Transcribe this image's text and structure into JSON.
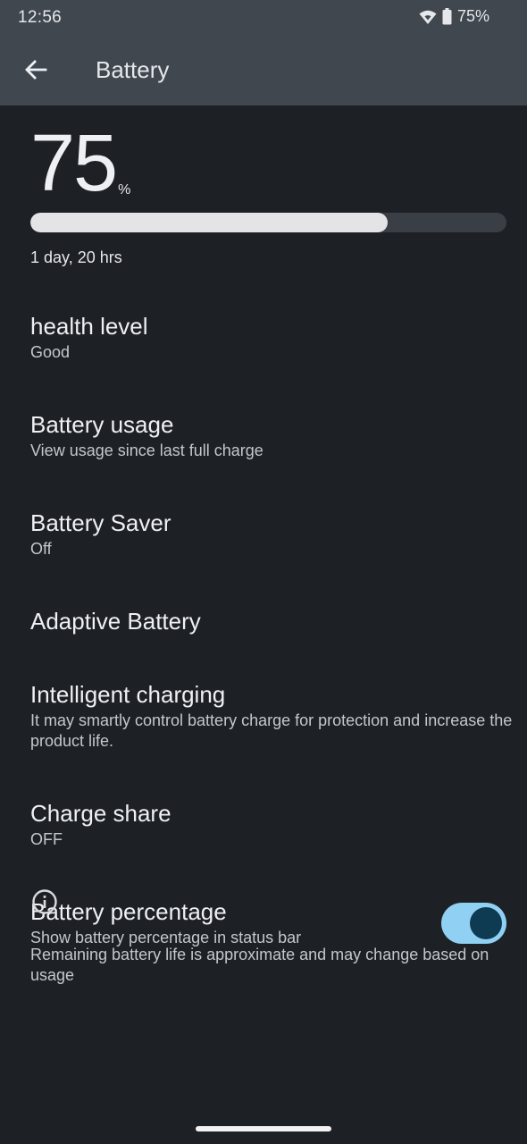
{
  "status_bar": {
    "time": "12:56",
    "battery_percent": "75%",
    "wifi_icon": "wifi-icon",
    "battery_icon": "battery-icon"
  },
  "app_bar": {
    "title": "Battery",
    "back_icon": "back-arrow-icon"
  },
  "battery": {
    "level": "75",
    "unit": "%",
    "level_fraction": 0.75,
    "remaining": "1 day, 20 hrs"
  },
  "items": [
    {
      "title": "health level",
      "subtitle": "Good"
    },
    {
      "title": "Battery usage",
      "subtitle": "View usage since last full charge"
    },
    {
      "title": "Battery Saver",
      "subtitle": "Off"
    },
    {
      "title": "Adaptive Battery",
      "subtitle": ""
    },
    {
      "title": "Intelligent charging",
      "subtitle": "It may smartly control battery charge for protection and increase the product life."
    },
    {
      "title": "Charge share",
      "subtitle": "OFF"
    },
    {
      "title": "Battery percentage",
      "subtitle": "Show battery percentage in status bar",
      "toggle_on": true
    }
  ],
  "footer": {
    "info_icon": "info-icon",
    "note": "Remaining battery life is approximate and may change based on usage"
  },
  "colors": {
    "background": "#1d2025",
    "header": "#40474f",
    "accent_toggle": "#8fd0f3",
    "toggle_knob": "#0e3a52"
  }
}
